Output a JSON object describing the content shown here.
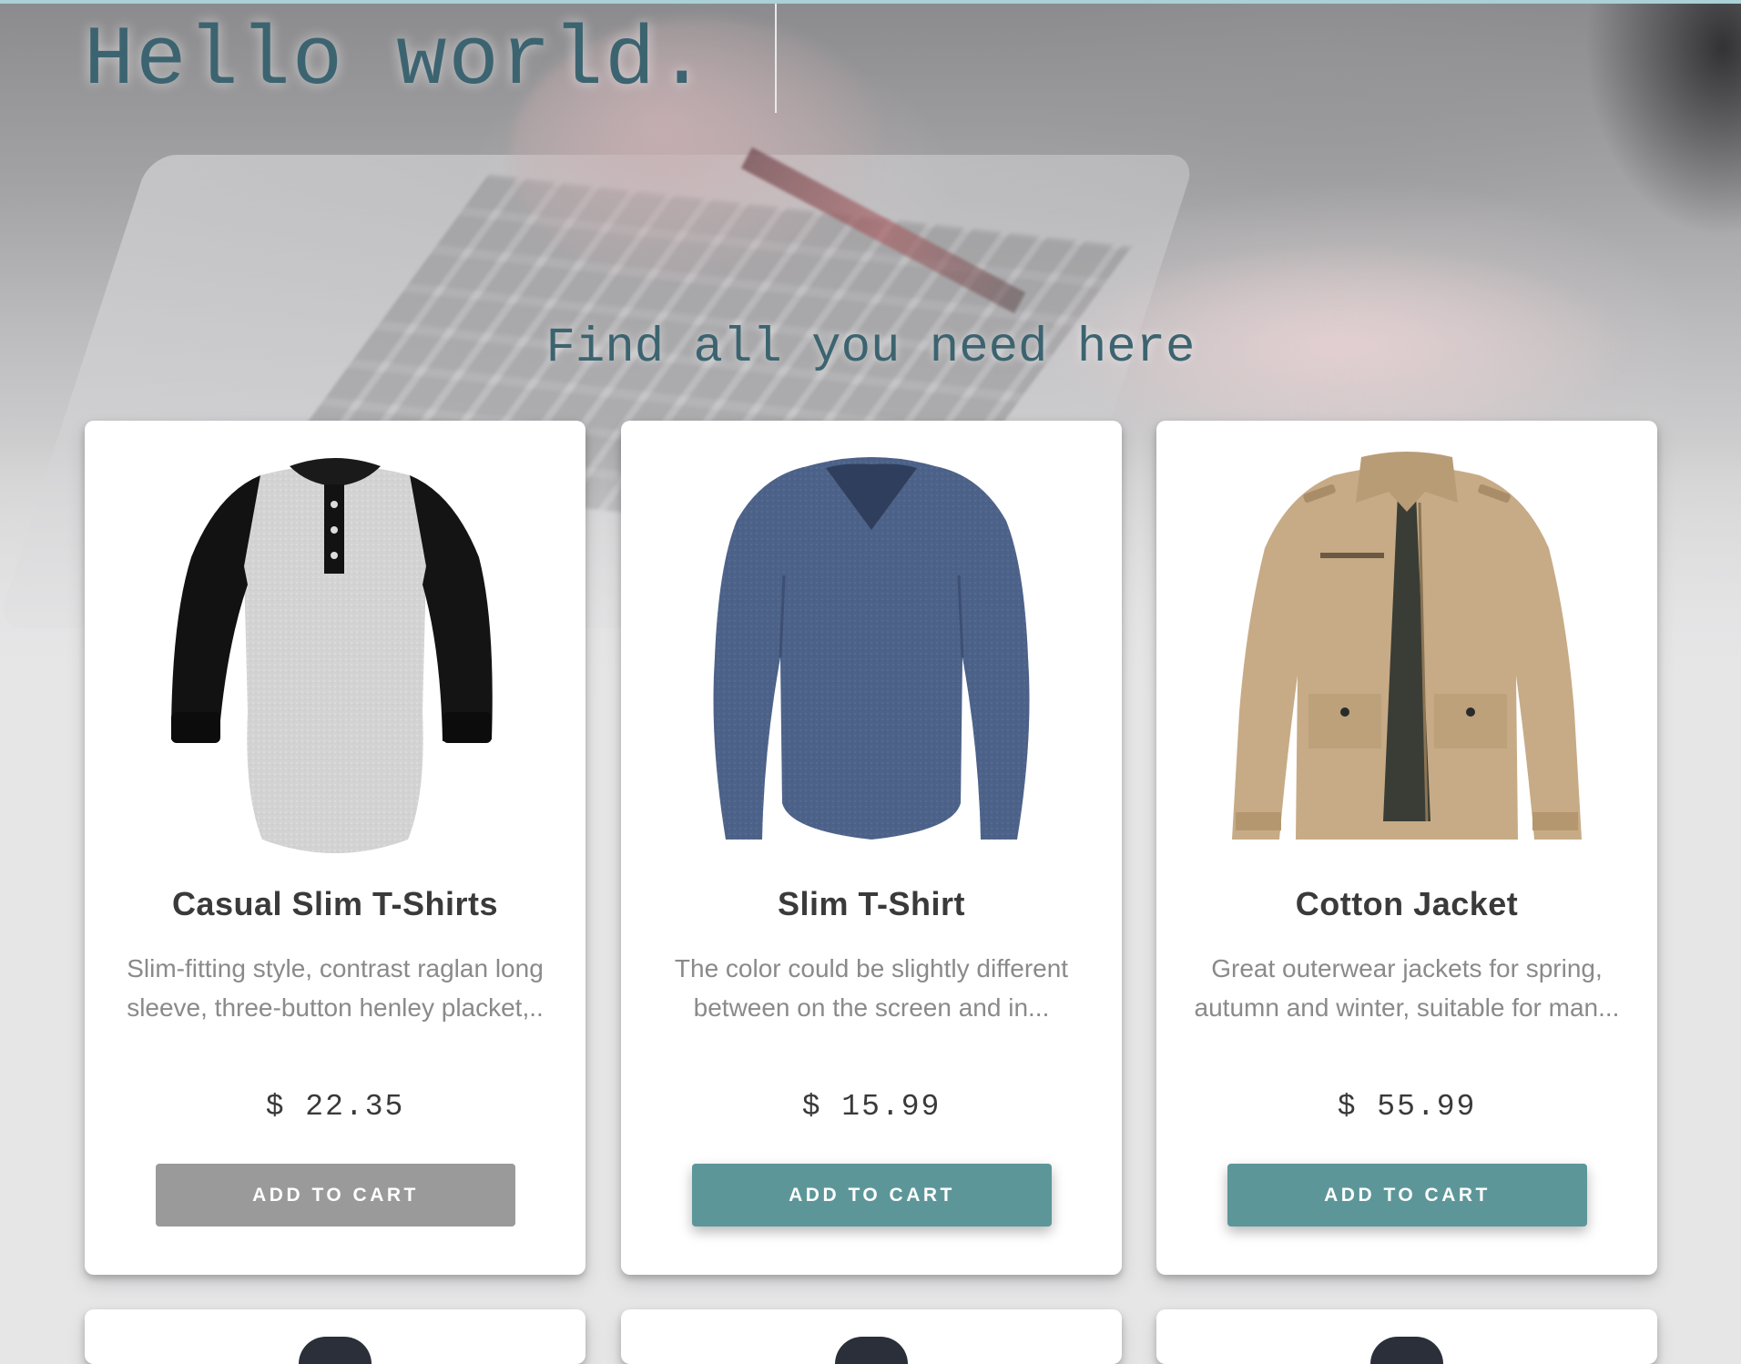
{
  "hero": {
    "title": "Hello world.",
    "tagline": "Find all you need here",
    "title_color": "#3c6470",
    "background_image": "blurred photo of hands typing on a laptop holding a credit card"
  },
  "accent_colors": {
    "button_teal": "#5d9699",
    "button_hover_gray": "#9a9a9a",
    "top_bar": "#a9d1d6"
  },
  "products": [
    {
      "name": "Casual Slim T-Shirts",
      "description": "Slim-fitting style, contrast raglan long sleeve, three-button henley placket,..",
      "price": "$ 22.35",
      "button_label": "ADD TO CART",
      "image": "raglan-henley-shirt-icon"
    },
    {
      "name": "Slim T-Shirt",
      "description": "The color could be slightly different between on the screen and in...",
      "price": "$ 15.99",
      "button_label": "ADD TO CART",
      "image": "long-sleeve-vneck-shirt-icon"
    },
    {
      "name": "Cotton Jacket",
      "description": "Great outerwear jackets for spring, autumn and winter, suitable for man...",
      "price": "$ 55.99",
      "button_label": "ADD TO CART",
      "image": "cotton-jacket-icon"
    }
  ]
}
